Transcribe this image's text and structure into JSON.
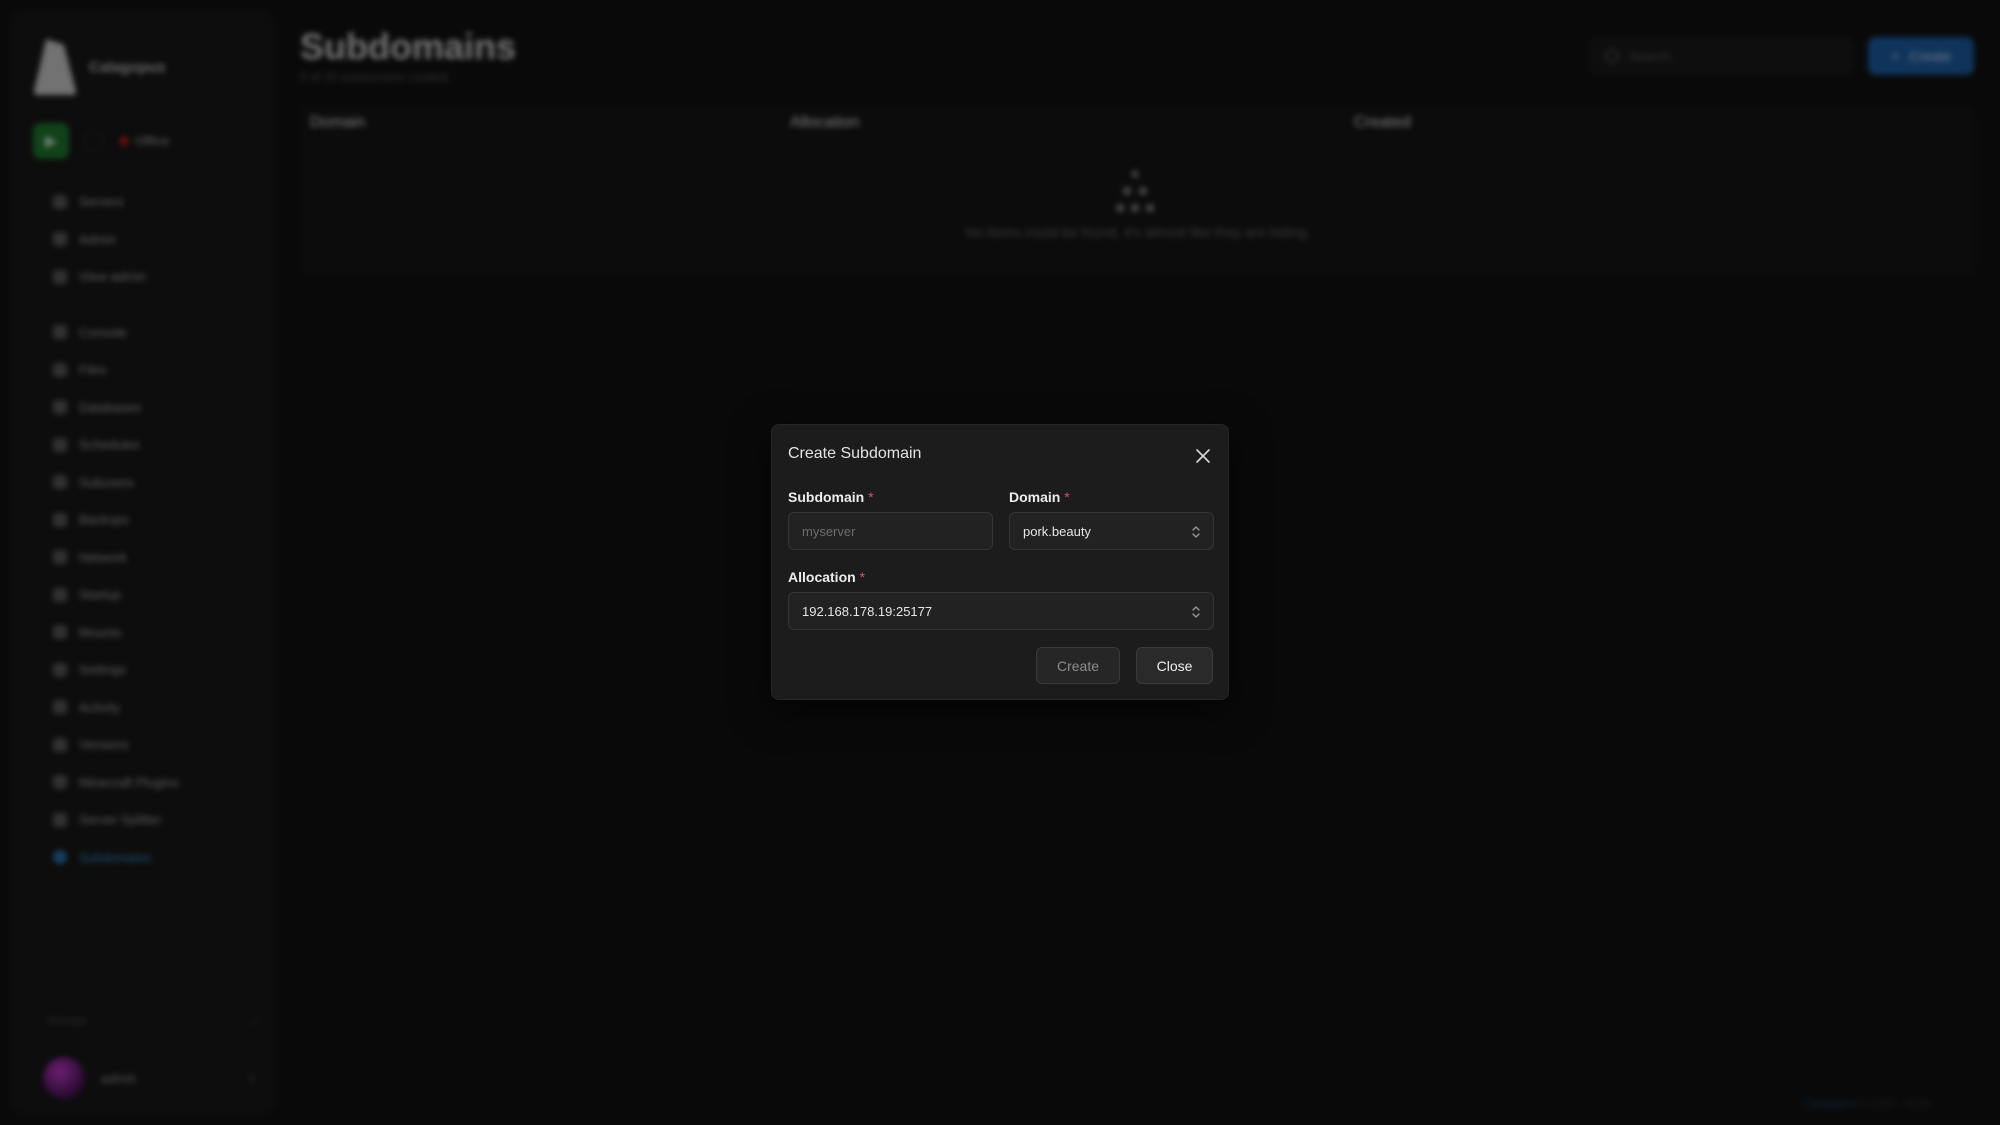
{
  "sidebar": {
    "app_name": "Calagopus",
    "server_status": "Offline",
    "nav_group_1": [
      {
        "label": "Servers",
        "icon": "server-icon"
      },
      {
        "label": "Admin",
        "icon": "admin-icon"
      },
      {
        "label": "View admin",
        "icon": "external-link-icon"
      }
    ],
    "nav_group_2": [
      {
        "label": "Console",
        "icon": "terminal-icon"
      },
      {
        "label": "Files",
        "icon": "folder-icon"
      },
      {
        "label": "Databases",
        "icon": "database-icon"
      },
      {
        "label": "Schedules",
        "icon": "clock-icon"
      },
      {
        "label": "Subusers",
        "icon": "users-icon"
      },
      {
        "label": "Backups",
        "icon": "archive-icon"
      },
      {
        "label": "Network",
        "icon": "network-icon"
      },
      {
        "label": "Startup",
        "icon": "play-icon"
      },
      {
        "label": "Mounts",
        "icon": "mount-icon"
      },
      {
        "label": "Settings",
        "icon": "gear-icon"
      },
      {
        "label": "Activity",
        "icon": "activity-icon"
      },
      {
        "label": "Versions",
        "icon": "tag-icon"
      },
      {
        "label": "Minecraft Plugins",
        "icon": "plugin-icon"
      },
      {
        "label": "Server Splitter",
        "icon": "split-icon"
      },
      {
        "label": "Subdomains",
        "icon": "globe-icon",
        "active": true
      }
    ],
    "footer_label": "Manage",
    "user_name": "admin"
  },
  "header": {
    "title": "Subdomains",
    "subtitle": "0 of 10 subdomains created",
    "search_placeholder": "Search...",
    "create_label": "Create"
  },
  "table": {
    "columns": [
      "Domain",
      "Allocation",
      "Created"
    ],
    "empty_message": "No items could be found, it's almost like they are hiding."
  },
  "footer": {
    "brand": "Calagopus",
    "version": "© 2025 - 2026"
  },
  "modal": {
    "title": "Create Subdomain",
    "subdomain": {
      "label": "Subdomain",
      "required_mark": "*",
      "placeholder": "myserver",
      "value": ""
    },
    "domain": {
      "label": "Domain",
      "required_mark": "*",
      "value": "pork.beauty"
    },
    "allocation": {
      "label": "Allocation",
      "required_mark": "*",
      "value": "192.168.178.19:25177"
    },
    "create_label": "Create",
    "close_label": "Close"
  },
  "colors": {
    "background": "#121212",
    "modal_bg": "#1c1c1c",
    "accent": "#1d5fa8",
    "required": "#e05353",
    "power_button": "#1e7a2e",
    "offline": "#b01a1a"
  }
}
